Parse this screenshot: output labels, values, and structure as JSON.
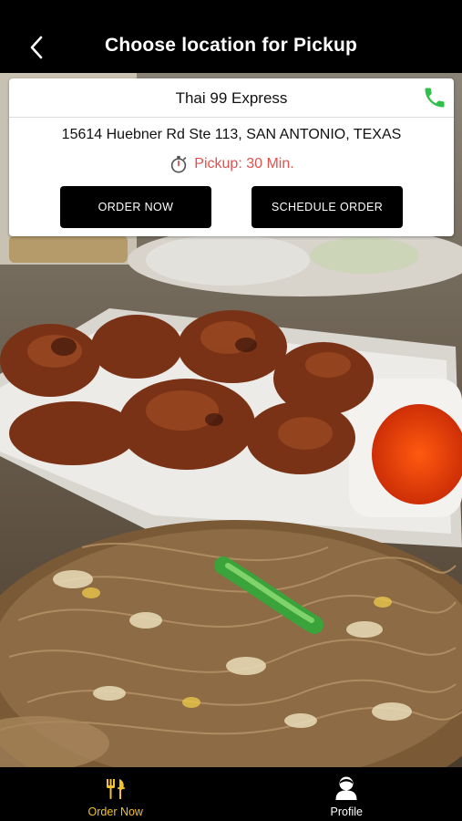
{
  "header": {
    "title": "Choose location for Pickup",
    "back_icon": "chevron-left-icon"
  },
  "location": {
    "name": "Thai 99 Express",
    "phone_icon": "phone-icon",
    "address": "15614 Huebner Rd Ste 113, SAN ANTONIO, TEXAS",
    "pickup_icon": "stopwatch-icon",
    "pickup_text": "Pickup: 30 Min.",
    "order_now_label": "ORDER NOW",
    "schedule_order_label": "SCHEDULE ORDER"
  },
  "tabbar": {
    "tabs": [
      {
        "label": "Order Now",
        "icon": "fork-knife-icon",
        "active": true
      },
      {
        "label": "Profile",
        "icon": "person-icon",
        "active": false
      }
    ]
  },
  "colors": {
    "accent": "#f2c12e",
    "pickup_red": "#e0504e",
    "phone_green": "#2fbf4a",
    "bar_bg": "#000000"
  }
}
